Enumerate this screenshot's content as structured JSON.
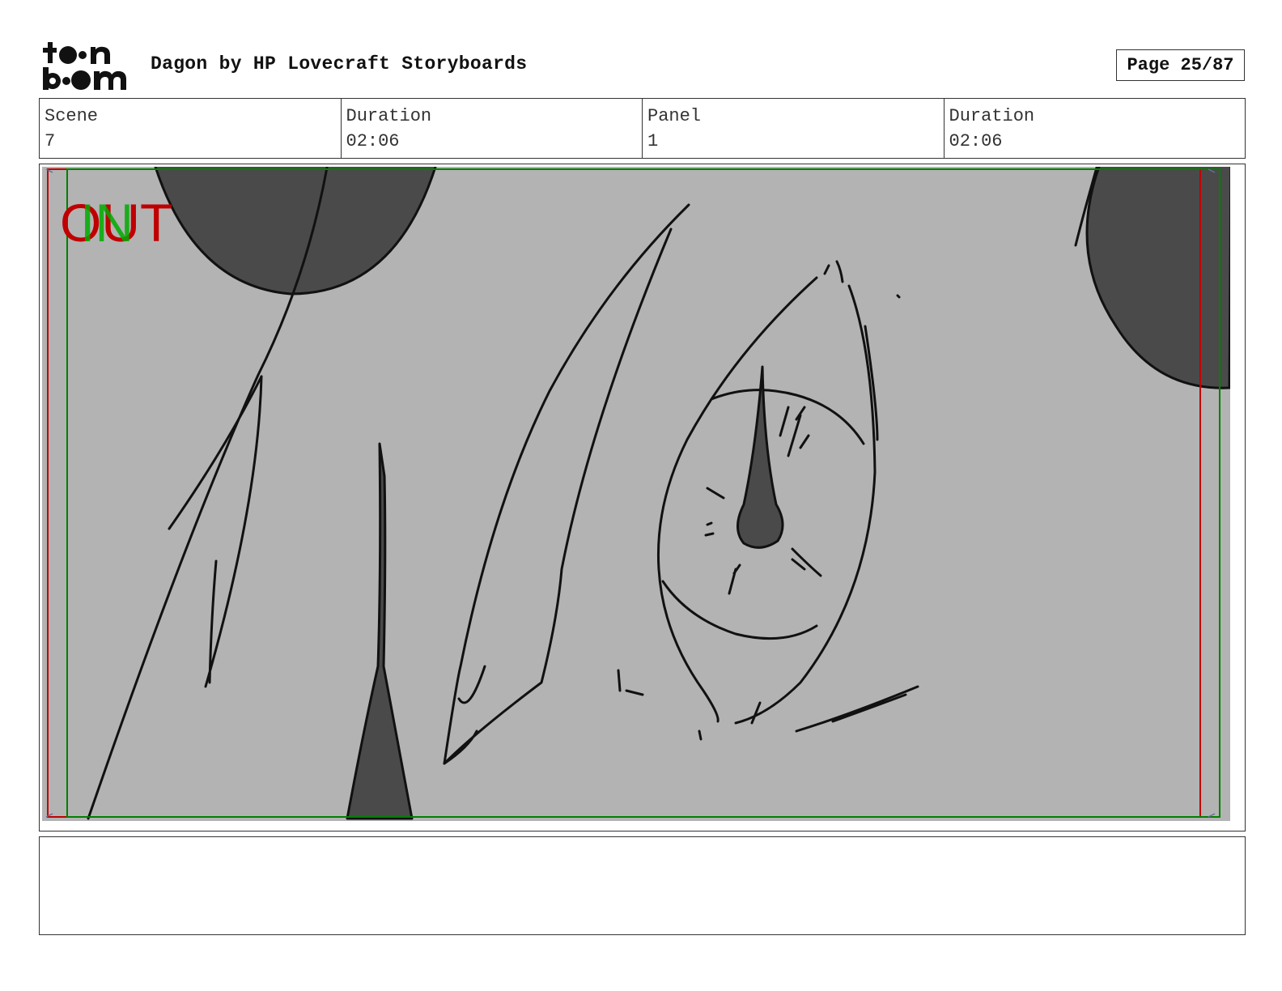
{
  "header": {
    "logo_text_top": "toon",
    "logo_text_bottom": "boom",
    "title": "Dagon by HP Lovecraft Storyboards",
    "page": "Page 25/87"
  },
  "info": {
    "scene_label": "Scene",
    "scene_value": "7",
    "scene_duration_label": "Duration",
    "scene_duration_value": "02:06",
    "panel_label": "Panel",
    "panel_value": "1",
    "panel_duration_label": "Duration",
    "panel_duration_value": "02:06"
  },
  "panel": {
    "out_label": "OUT",
    "in_label": "IN",
    "colors": {
      "background": "#b3b3b3",
      "fill": "#4a4a4a",
      "out_frame": "#c00000",
      "in_frame": "#008000"
    }
  },
  "notes": {
    "text": ""
  }
}
